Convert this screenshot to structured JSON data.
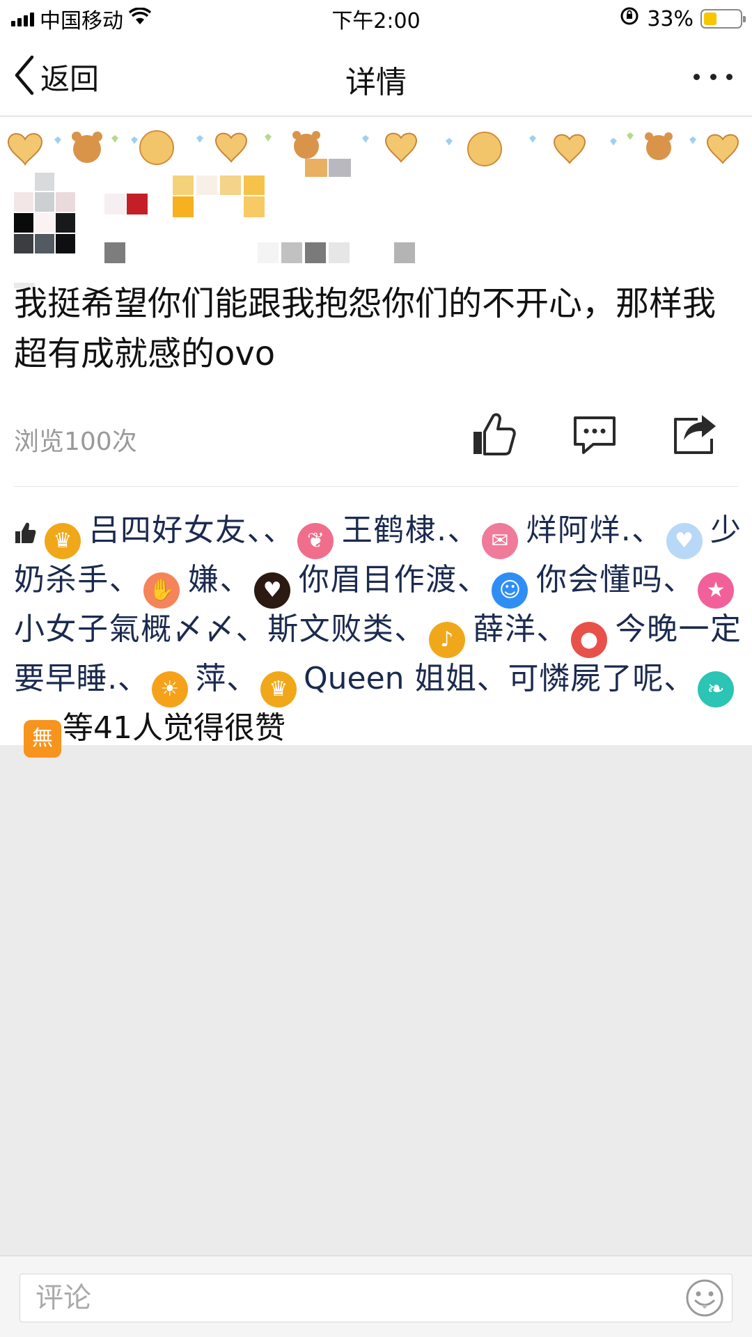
{
  "status_bar": {
    "carrier": "中国移动",
    "time": "下午2:00",
    "battery": "33%",
    "battery_level": 0.33,
    "icons": [
      "signal-icon",
      "wifi-icon",
      "rotation-lock-icon",
      "battery-icon"
    ]
  },
  "nav": {
    "back_label": "返回",
    "title": "详情",
    "icons": [
      "chevron-left-icon",
      "more-icon"
    ]
  },
  "post": {
    "text": "我挺希望你们能跟我抱怨你们的不开心，那样我超有成就感的ovo",
    "views": "浏览100次",
    "actions": [
      "like-icon",
      "comment-icon",
      "share-icon"
    ]
  },
  "likes": {
    "thumb_icon": "thumbs-up-icon",
    "users": [
      {
        "name": "吕四好女友、、",
        "icon": "crown-icon",
        "color": "#f0a81a"
      },
      {
        "name": "王鹤棣.、",
        "icon": "wings-icon",
        "color": "#f06e8c"
      },
      {
        "name": "烊阿烊.、",
        "icon": "envelope-heart-icon",
        "color": "#f07a9a"
      },
      {
        "name": "少奶杀手、",
        "icon": "heart-icon",
        "color": "#b8d8f8"
      },
      {
        "name": "嫌、",
        "icon": "hand-icon",
        "color": "#f5845a"
      },
      {
        "name": "你眉目作渡、",
        "icon": "heart-icon",
        "color": "#2a1a12"
      },
      {
        "name": "你会懂吗、",
        "icon": "cat-icon",
        "color": "#2f8ef4"
      },
      {
        "name": "小女子氣概〆〆、斯文败类、",
        "icon": "star-icon",
        "color": "#f2609a"
      },
      {
        "name": "薛洋、",
        "icon": "music-note-icon",
        "color": "#f0a81a"
      },
      {
        "name": "今晚一定要早睡.、",
        "icon": "cherry-icon",
        "color": "#e8504a"
      },
      {
        "name": "萍、",
        "icon": "sun-icon",
        "color": "#f5a21a"
      },
      {
        "name": "Queen 姐姐、可憐屍了呢、",
        "icon": "crown-icon",
        "color": "#f0a81a"
      },
      {
        "name": "",
        "icon": "leaf-icon",
        "color": "#2cc4b4"
      }
    ],
    "badge_text": "無",
    "badge_icon": "wu-badge-icon",
    "tail": "等41人觉得很赞"
  },
  "comment_bar": {
    "placeholder": "评论",
    "icon": "emoji-icon"
  }
}
